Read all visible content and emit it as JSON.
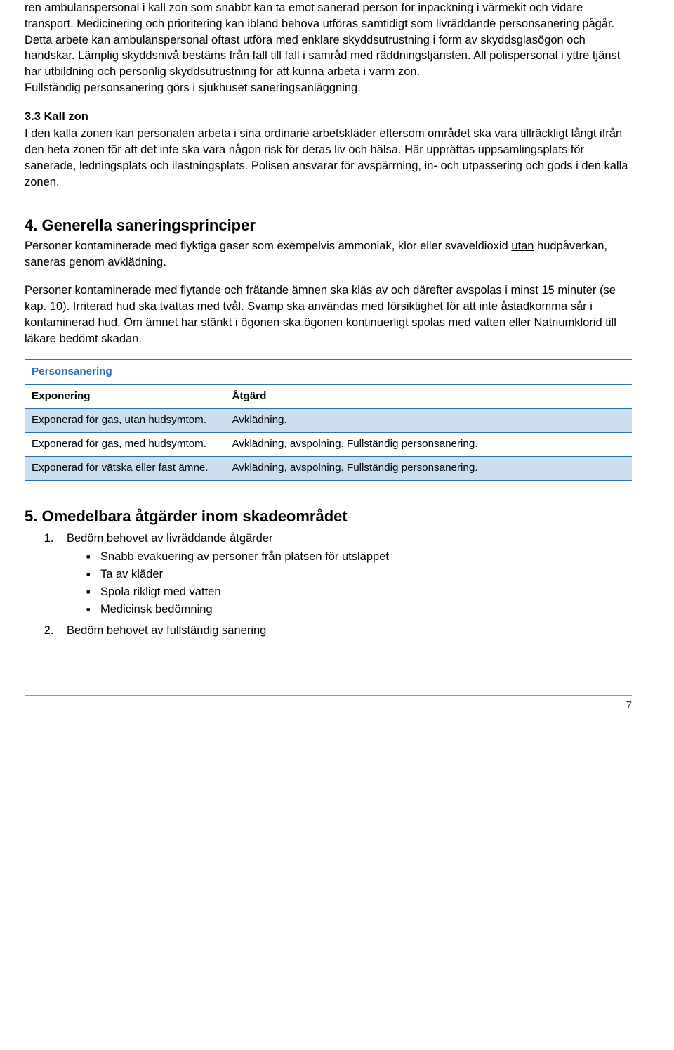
{
  "para1": "ren ambulanspersonal i kall zon som snabbt kan ta emot sanerad person för inpackning i värmekit och vidare transport. Medicinering och prioritering kan ibland behöva utföras samtidigt som livräddande personsanering pågår. Detta arbete kan ambulanspersonal oftast utföra med enklare skyddsutrustning i form av skyddsglasögon och handskar. Lämplig skyddsnivå bestäms från fall till fall i samråd med räddningstjänsten. All polispersonal i yttre tjänst har utbildning och personlig skyddsutrustning för att kunna arbeta i varm zon.",
  "para1b": "Fullständig personsanering görs i sjukhuset saneringsanläggning.",
  "s33": {
    "heading": "3.3 Kall zon",
    "body": "I den kalla zonen kan personalen arbeta i sina ordinarie arbetskläder eftersom området ska vara tillräckligt långt ifrån den heta zonen för att det inte ska vara någon risk för deras liv och hälsa. Här upprättas uppsamlingsplats för sanerade, ledningsplats och ilastningsplats. Polisen ansvarar för avspärrning, in- och utpassering och gods i den kalla zonen."
  },
  "s4": {
    "heading": "4. Generella saneringsprinciper",
    "p1a": "Personer kontaminerade med flyktiga gaser som exempelvis ammoniak, klor eller svaveldioxid ",
    "p1u": "utan",
    "p1b": " hudpåverkan, saneras genom avklädning.",
    "p2": "Personer kontaminerade med flytande och frätande ämnen ska kläs av och därefter avspolas i minst 15 minuter (se kap. 10). Irriterad hud ska tvättas med tvål. Svamp ska användas med försiktighet för att inte åstadkomma sår i kontaminerad hud. Om ämnet har stänkt i ögonen ska ögonen kontinuerligt spolas med vatten eller Natriumklorid till läkare bedömt skadan."
  },
  "table": {
    "title": "Personsanering",
    "h1": "Exponering",
    "h2": "Åtgärd",
    "rows": [
      {
        "c1": "Exponerad för gas, utan hudsymtom.",
        "c2": "Avklädning."
      },
      {
        "c1": "Exponerad för gas, med hudsymtom.",
        "c2": "Avklädning, avspolning. Fullständig personsanering."
      },
      {
        "c1": "Exponerad för vätska eller fast ämne.",
        "c2": "Avklädning, avspolning. Fullständig personsanering."
      }
    ]
  },
  "s5": {
    "heading": "5. Omedelbara åtgärder inom skadeområdet",
    "li1": "Bedöm behovet av livräddande åtgärder",
    "sub": [
      "Snabb evakuering av personer från platsen för utsläppet",
      "Ta av kläder",
      "Spola rikligt med vatten",
      "Medicinsk bedömning"
    ],
    "li2": "Bedöm behovet av fullständig sanering"
  },
  "page": "7"
}
